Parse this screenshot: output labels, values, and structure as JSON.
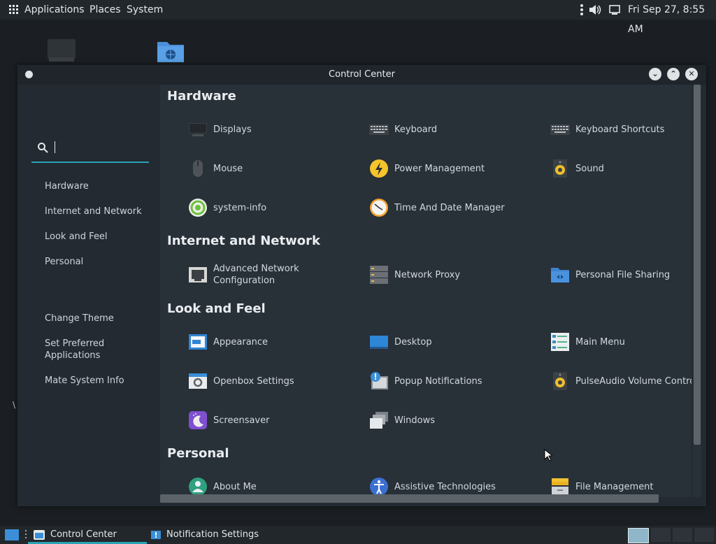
{
  "top_panel": {
    "menus": [
      "Applications",
      "Places",
      "System"
    ],
    "clock": "Fri Sep 27,  8:55 AM"
  },
  "window": {
    "title": "Control Center"
  },
  "sidebar": {
    "categories": [
      "Hardware",
      "Internet and Network",
      "Look and Feel",
      "Personal"
    ],
    "actions": [
      "Change Theme",
      "Set Preferred\nApplications",
      "Mate System Info"
    ]
  },
  "sections": [
    {
      "title": "Hardware",
      "items": [
        {
          "label": "Displays",
          "icon": "display-icon"
        },
        {
          "label": "Keyboard",
          "icon": "keyboard-icon"
        },
        {
          "label": "Keyboard Shortcuts",
          "icon": "keyboard-shortcuts-icon"
        },
        {
          "label": "Mouse",
          "icon": "mouse-icon"
        },
        {
          "label": "Power Management",
          "icon": "power-icon"
        },
        {
          "label": "Sound",
          "icon": "speaker-icon"
        },
        {
          "label": "system-info",
          "icon": "system-info-icon"
        },
        {
          "label": "Time And Date Manager",
          "icon": "clock-icon"
        }
      ]
    },
    {
      "title": "Internet and Network",
      "items": [
        {
          "label": "Advanced Network\nConfiguration",
          "icon": "network-card-icon"
        },
        {
          "label": "Network Proxy",
          "icon": "proxy-server-icon"
        },
        {
          "label": "Personal File Sharing",
          "icon": "shared-folder-icon"
        }
      ]
    },
    {
      "title": "Look and Feel",
      "items": [
        {
          "label": "Appearance",
          "icon": "appearance-icon"
        },
        {
          "label": "Desktop",
          "icon": "desktop-icon"
        },
        {
          "label": "Main Menu",
          "icon": "main-menu-icon"
        },
        {
          "label": "Openbox Settings",
          "icon": "openbox-icon"
        },
        {
          "label": "Popup Notifications",
          "icon": "notification-icon"
        },
        {
          "label": "PulseAudio Volume Control",
          "icon": "speaker-icon"
        },
        {
          "label": "Screensaver",
          "icon": "screensaver-icon"
        },
        {
          "label": "Windows",
          "icon": "windows-icon"
        }
      ]
    },
    {
      "title": "Personal",
      "items": [
        {
          "label": "About Me",
          "icon": "user-icon"
        },
        {
          "label": "Assistive Technologies",
          "icon": "accessibility-icon"
        },
        {
          "label": "File Management",
          "icon": "file-cabinet-icon"
        }
      ]
    }
  ],
  "taskbar": {
    "tasks": [
      "Control Center",
      "Notification Settings"
    ]
  },
  "colors": {
    "accent": "#2aa3b6",
    "window_bg": "#283038",
    "sidebar_bg": "#232a31"
  }
}
